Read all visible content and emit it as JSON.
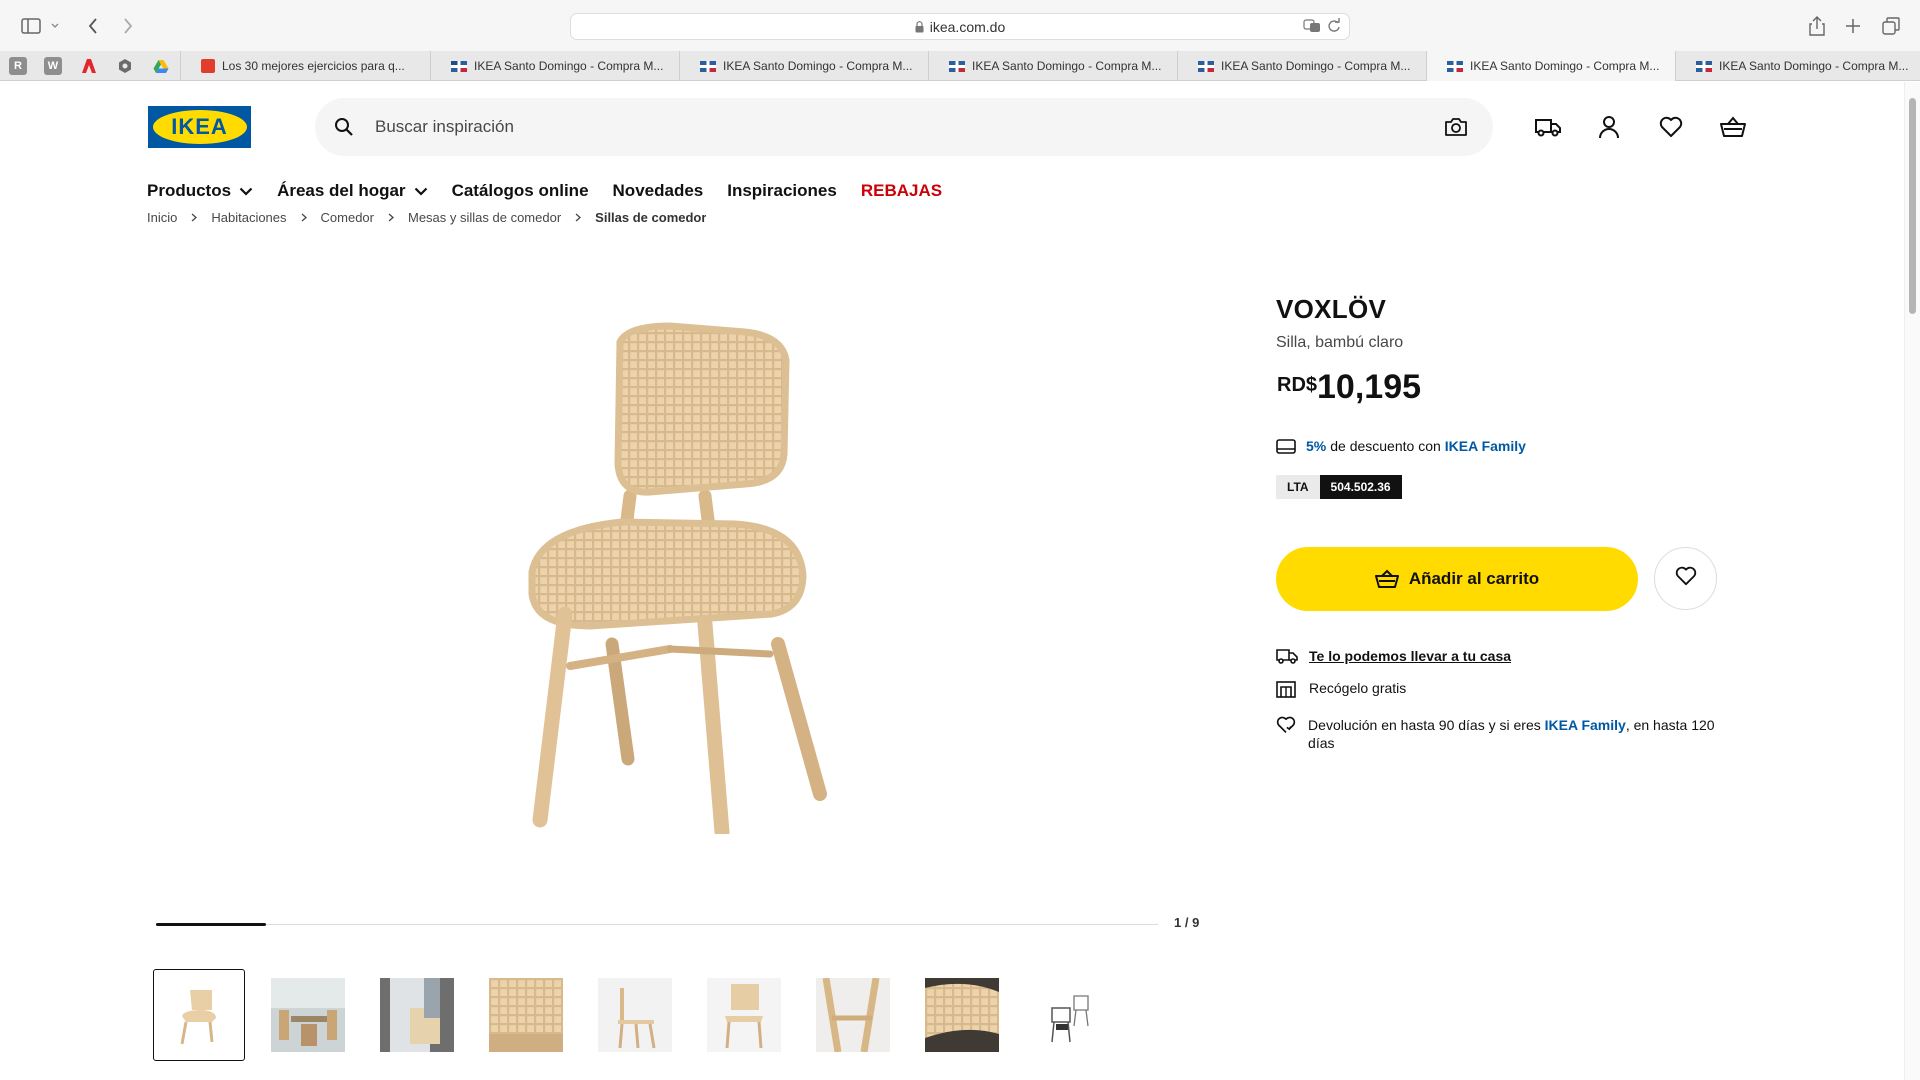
{
  "browser": {
    "url": "ikea.com.do",
    "tabs": [
      {
        "title": "Los 30 mejores ejercicios para q...",
        "active": false
      },
      {
        "title": "IKEA Santo Domingo - Compra M...",
        "active": false
      },
      {
        "title": "IKEA Santo Domingo - Compra M...",
        "active": false
      },
      {
        "title": "IKEA Santo Domingo - Compra M...",
        "active": false
      },
      {
        "title": "IKEA Santo Domingo - Compra M...",
        "active": false
      },
      {
        "title": "IKEA Santo Domingo - Compra M...",
        "active": true
      },
      {
        "title": "IKEA Santo Domingo - Compra M...",
        "active": false
      }
    ],
    "pinned": [
      {
        "label": "R",
        "color": "#8e8e8e"
      },
      {
        "label": "W",
        "color": "#8e8e8e"
      },
      {
        "label": "",
        "color": "#e4262c"
      },
      {
        "label": "",
        "color": "#6b6b6b"
      },
      {
        "label": "",
        "color": "#34a853"
      }
    ]
  },
  "header": {
    "logo_text": "IKEA",
    "search_placeholder": "Buscar inspiración"
  },
  "nav": {
    "items": [
      {
        "label": "Productos",
        "dropdown": true
      },
      {
        "label": "Áreas del hogar",
        "dropdown": true
      },
      {
        "label": "Catálogos online",
        "dropdown": false
      },
      {
        "label": "Novedades",
        "dropdown": false
      },
      {
        "label": "Inspiraciones",
        "dropdown": false
      },
      {
        "label": "REBAJAS",
        "dropdown": false,
        "sale": true
      }
    ]
  },
  "breadcrumb": [
    "Inicio",
    "Habitaciones",
    "Comedor",
    "Mesas y sillas de comedor",
    "Sillas de comedor"
  ],
  "gallery": {
    "counter": "1 / 9",
    "progress": 0.11,
    "thumbnails": 9,
    "selected_index": 0
  },
  "product": {
    "name": "VOXLÖV",
    "description": "Silla, bambú claro",
    "currency": "RD$",
    "price": "10,195",
    "family_pct": "5%",
    "family_text": "de descuento con",
    "family_brand": "IKEA Family",
    "article_label": "LTA",
    "article_number": "504.502.36",
    "add_to_cart": "Añadir al carrito"
  },
  "services": {
    "delivery": "Te lo podemos llevar a tu casa",
    "pickup": "Recógelo gratis",
    "return_pre": "Devolución en hasta 90 días y si eres",
    "return_brand": "IKEA Family",
    "return_post": ", en hasta 120 días"
  },
  "colors": {
    "ikea_blue": "#0058a3",
    "ikea_yellow": "#ffdb00",
    "sale_red": "#cc0008"
  }
}
